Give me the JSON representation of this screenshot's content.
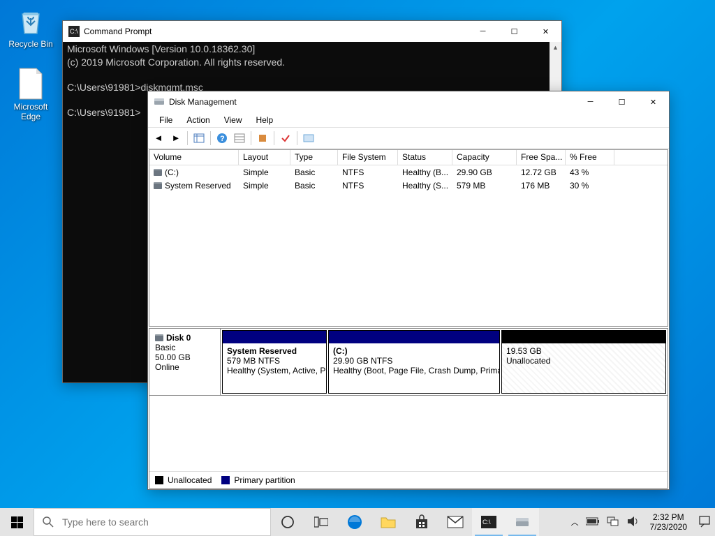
{
  "desktop": {
    "icons": [
      {
        "label": "Recycle Bin"
      },
      {
        "label": "Microsoft Edge"
      }
    ]
  },
  "cmd": {
    "title": "Command Prompt",
    "line1": "Microsoft Windows [Version 10.0.18362.30]",
    "line2": "(c) 2019 Microsoft Corporation. All rights reserved.",
    "line3": "C:\\Users\\91981>diskmgmt.msc",
    "line4": "C:\\Users\\91981>"
  },
  "dm": {
    "title": "Disk Management",
    "menu": {
      "file": "File",
      "action": "Action",
      "view": "View",
      "help": "Help"
    },
    "cols": {
      "volume": "Volume",
      "layout": "Layout",
      "type": "Type",
      "fs": "File System",
      "status": "Status",
      "capacity": "Capacity",
      "free": "Free Spa...",
      "pct": "% Free"
    },
    "vols": [
      {
        "volume": "(C:)",
        "layout": "Simple",
        "type": "Basic",
        "fs": "NTFS",
        "status": "Healthy (B...",
        "capacity": "29.90 GB",
        "free": "12.72 GB",
        "pct": "43 %"
      },
      {
        "volume": "System Reserved",
        "layout": "Simple",
        "type": "Basic",
        "fs": "NTFS",
        "status": "Healthy (S...",
        "capacity": "579 MB",
        "free": "176 MB",
        "pct": "30 %"
      }
    ],
    "disk": {
      "name": "Disk 0",
      "type": "Basic",
      "size": "50.00 GB",
      "status": "Online"
    },
    "parts": [
      {
        "name": "System Reserved",
        "size": "579 MB NTFS",
        "status": "Healthy (System, Active, P"
      },
      {
        "name": "(C:)",
        "size": "29.90 GB NTFS",
        "status": "Healthy (Boot, Page File, Crash Dump, Prima"
      },
      {
        "name": "",
        "size": "19.53 GB",
        "status": "Unallocated"
      }
    ],
    "legend": {
      "unalloc": "Unallocated",
      "primary": "Primary partition"
    }
  },
  "taskbar": {
    "search_placeholder": "Type here to search",
    "time": "2:32 PM",
    "date": "7/23/2020"
  }
}
